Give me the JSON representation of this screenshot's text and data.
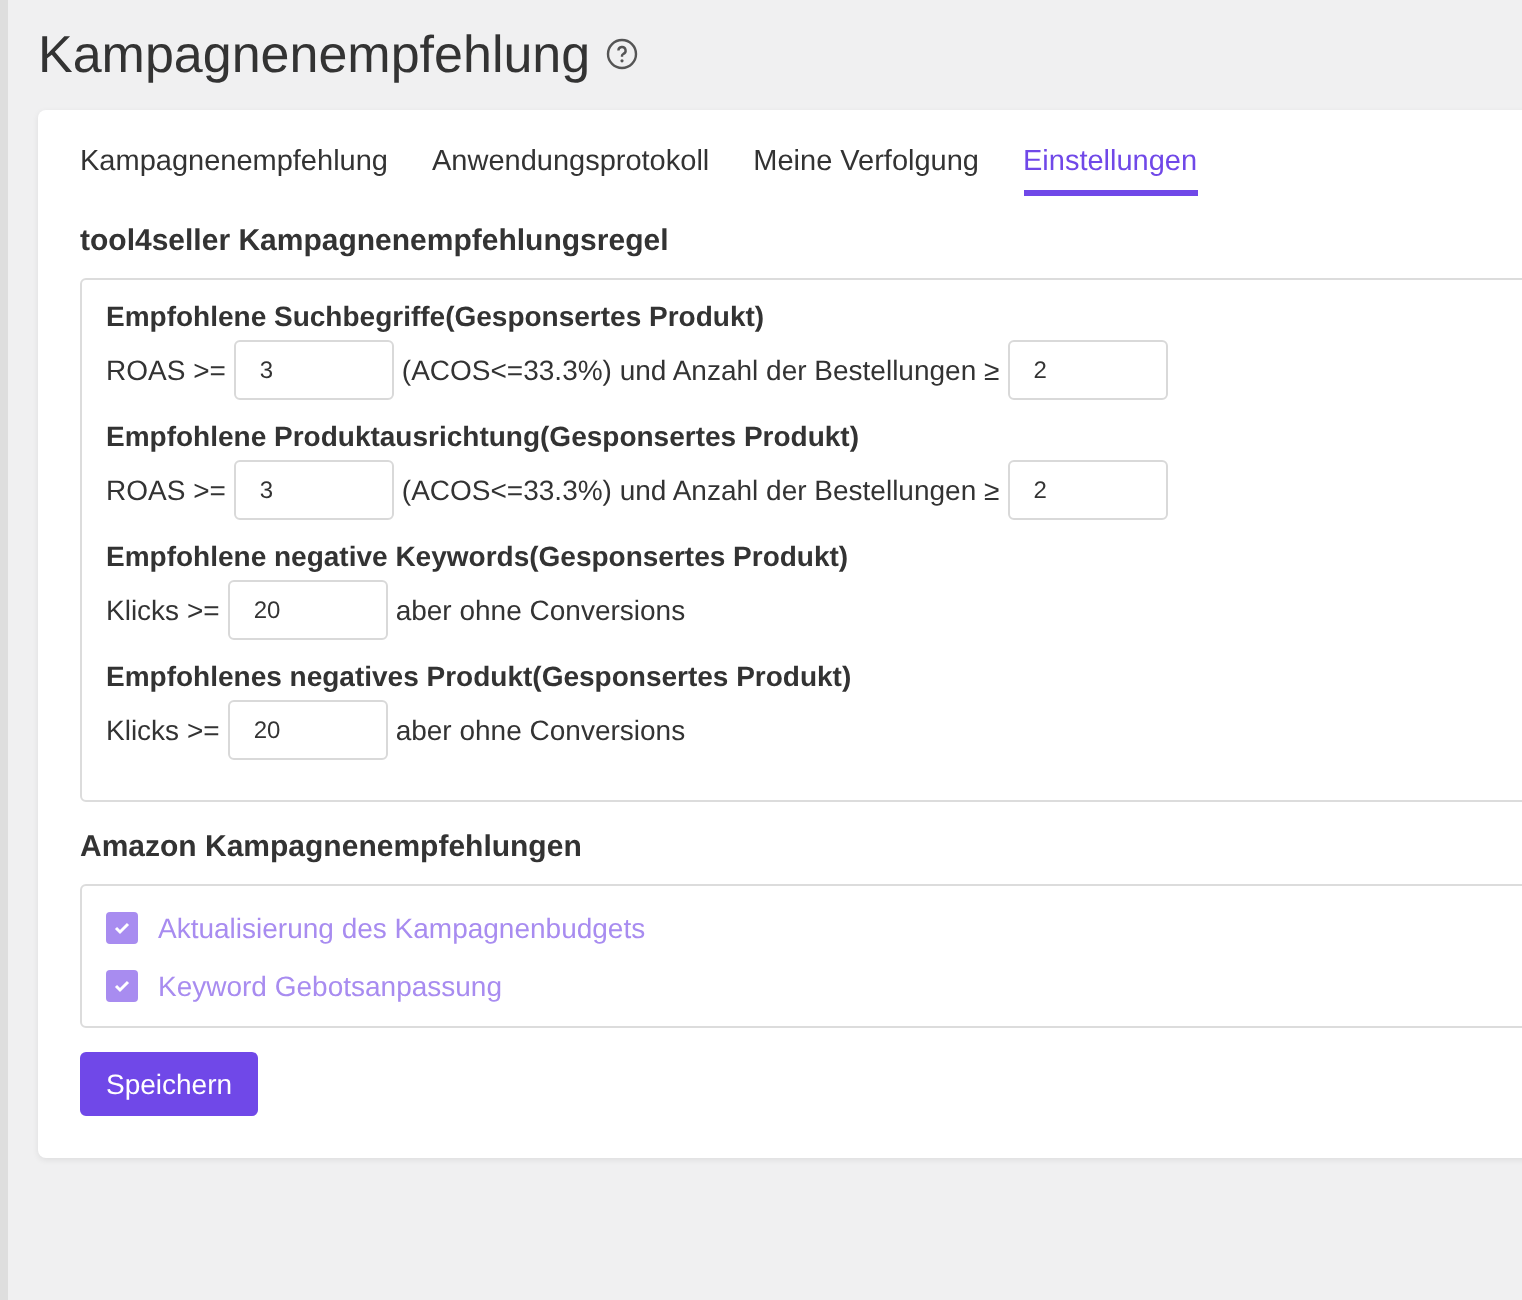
{
  "page_title": "Kampagnenempfehlung",
  "tabs": [
    {
      "label": "Kampagnenempfehlung",
      "selected": false
    },
    {
      "label": "Anwendungsprotokoll",
      "selected": false
    },
    {
      "label": "Meine Verfolgung",
      "selected": false
    },
    {
      "label": "Einstellungen",
      "selected": true
    }
  ],
  "rules_section": {
    "title": "tool4seller Kampagnenempfehlungsregel",
    "rules": [
      {
        "title": "Empfohlene Suchbegriffe(Gesponsertes Produkt)",
        "parts": [
          {
            "kind": "text",
            "text": "ROAS >="
          },
          {
            "kind": "input",
            "value": "3"
          },
          {
            "kind": "text",
            "text": "(ACOS<=33.3%) und Anzahl der Bestellungen ≥"
          },
          {
            "kind": "input",
            "value": "2"
          }
        ]
      },
      {
        "title": "Empfohlene Produktausrichtung(Gesponsertes Produkt)",
        "parts": [
          {
            "kind": "text",
            "text": "ROAS >="
          },
          {
            "kind": "input",
            "value": "3"
          },
          {
            "kind": "text",
            "text": "(ACOS<=33.3%) und Anzahl der Bestellungen ≥"
          },
          {
            "kind": "input",
            "value": "2"
          }
        ]
      },
      {
        "title": "Empfohlene negative Keywords(Gesponsertes Produkt)",
        "parts": [
          {
            "kind": "text",
            "text": "Klicks >="
          },
          {
            "kind": "input",
            "value": "20"
          },
          {
            "kind": "text",
            "text": "aber ohne Conversions"
          }
        ]
      },
      {
        "title": "Empfohlenes negatives Produkt(Gesponsertes Produkt)",
        "parts": [
          {
            "kind": "text",
            "text": "Klicks >="
          },
          {
            "kind": "input",
            "value": "20"
          },
          {
            "kind": "text",
            "text": "aber ohne Conversions"
          }
        ]
      }
    ]
  },
  "amazon_section": {
    "title": "Amazon Kampagnenempfehlungen",
    "options": [
      {
        "label": "Aktualisierung des Kampagnenbudgets",
        "checked": true,
        "disabled": true
      },
      {
        "label": "Keyword Gebotsanpassung",
        "checked": true,
        "disabled": true
      }
    ]
  },
  "save_button": "Speichern"
}
